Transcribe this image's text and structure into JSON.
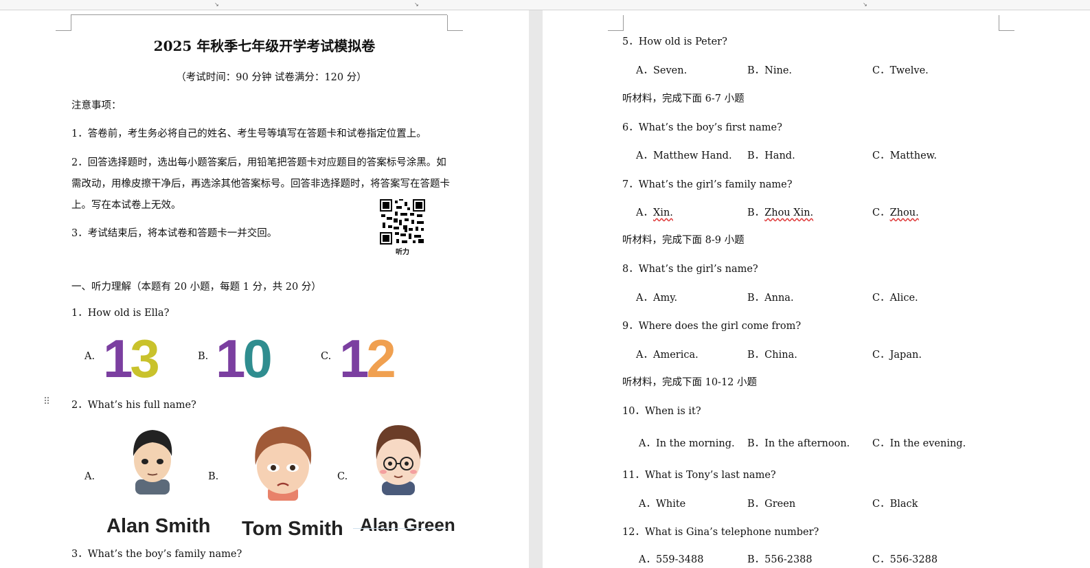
{
  "page1": {
    "title": "2025 年秋季七年级开学考试模拟卷",
    "subtitle": "（考试时间：90 分钟    试卷满分：120 分）",
    "notice_heading": "注意事项：",
    "notice_1": "1．答卷前，考生务必将自己的姓名、考生号等填写在答题卡和试卷指定位置上。",
    "notice_2_line1": "2．回答选择题时，选出每小题答案后，用铅笔把答题卡对应题目的答案标号涂黑。如",
    "notice_2_line2": "需改动，用橡皮擦干净后，再选涂其他答案标号。回答非选择题时，将答案写在答题卡",
    "notice_2_line3": "上。写在本试卷上无效。",
    "notice_3": "3．考试结束后，将本试卷和答题卡一并交回。",
    "qr_caption": "听力",
    "section_heading": "一、听力理解（本题有 20 小题，每题 1 分，共 20 分）",
    "q1": {
      "text": "1．How old is Ella?",
      "options": [
        {
          "label": "A.",
          "number": "13",
          "colors": [
            "#7b3fa0",
            "#c9c22c"
          ]
        },
        {
          "label": "B.",
          "number": "10",
          "colors": [
            "#7b3fa0",
            "#2f8d8f"
          ]
        },
        {
          "label": "C.",
          "number": "12",
          "colors": [
            "#7b3fa0",
            "#f0a050"
          ]
        }
      ]
    },
    "q2": {
      "text": "2．What’s his full name?",
      "options": [
        {
          "label": "A.",
          "caption": "Alan Smith"
        },
        {
          "label": "B.",
          "caption": "Tom Smith"
        },
        {
          "label": "C.",
          "caption": "Alan Green"
        }
      ]
    },
    "q3": {
      "text": "3．What’s the boy’s family name?"
    }
  },
  "page2": {
    "items": [
      {
        "kind": "q",
        "text": "5．How old is Peter?"
      },
      {
        "kind": "opts",
        "a": "A．Seven.",
        "b": "B．Nine.",
        "c": "C．Twelve."
      },
      {
        "kind": "h",
        "text": "听材料，完成下面 6-7 小题"
      },
      {
        "kind": "q",
        "text": "6．What’s the boy’s first name?"
      },
      {
        "kind": "opts",
        "a": "A．Matthew Hand.",
        "b": "B．Hand.",
        "c": "C．Matthew."
      },
      {
        "kind": "q",
        "text": "7．What’s the girl’s family name?"
      },
      {
        "kind": "opts",
        "a": "A．Xin.",
        "b": "B．Zhou Xin.",
        "c": "C．Zhou."
      },
      {
        "kind": "h",
        "text": "听材料，完成下面 8-9 小题"
      },
      {
        "kind": "q",
        "text": "8．What’s the girl’s name?"
      },
      {
        "kind": "opts",
        "a": "A．Amy.",
        "b": "B．Anna.",
        "c": "C．Alice."
      },
      {
        "kind": "q",
        "text": "9．Where does the girl  come from?"
      },
      {
        "kind": "opts",
        "a": "A．America.",
        "b": "B．China.",
        "c": "C．Japan."
      },
      {
        "kind": "h",
        "text": "听材料，完成下面 10-12 小题"
      },
      {
        "kind": "q",
        "text": "10．When is it?"
      },
      {
        "kind": "opts",
        "a": "A．In the morning.",
        "b": "B．In the afternoon.",
        "c": "C．In the evening."
      },
      {
        "kind": "q",
        "text": "11．What is Tony’s last name?"
      },
      {
        "kind": "opts",
        "a": "A．White",
        "b": "B．Green",
        "c": "C．Black"
      },
      {
        "kind": "q",
        "text": "12．What is Gina’s telephone number?"
      },
      {
        "kind": "opts",
        "a": "A．559-3488",
        "b": "B．556-2388",
        "c": "C．556-3288"
      }
    ]
  }
}
